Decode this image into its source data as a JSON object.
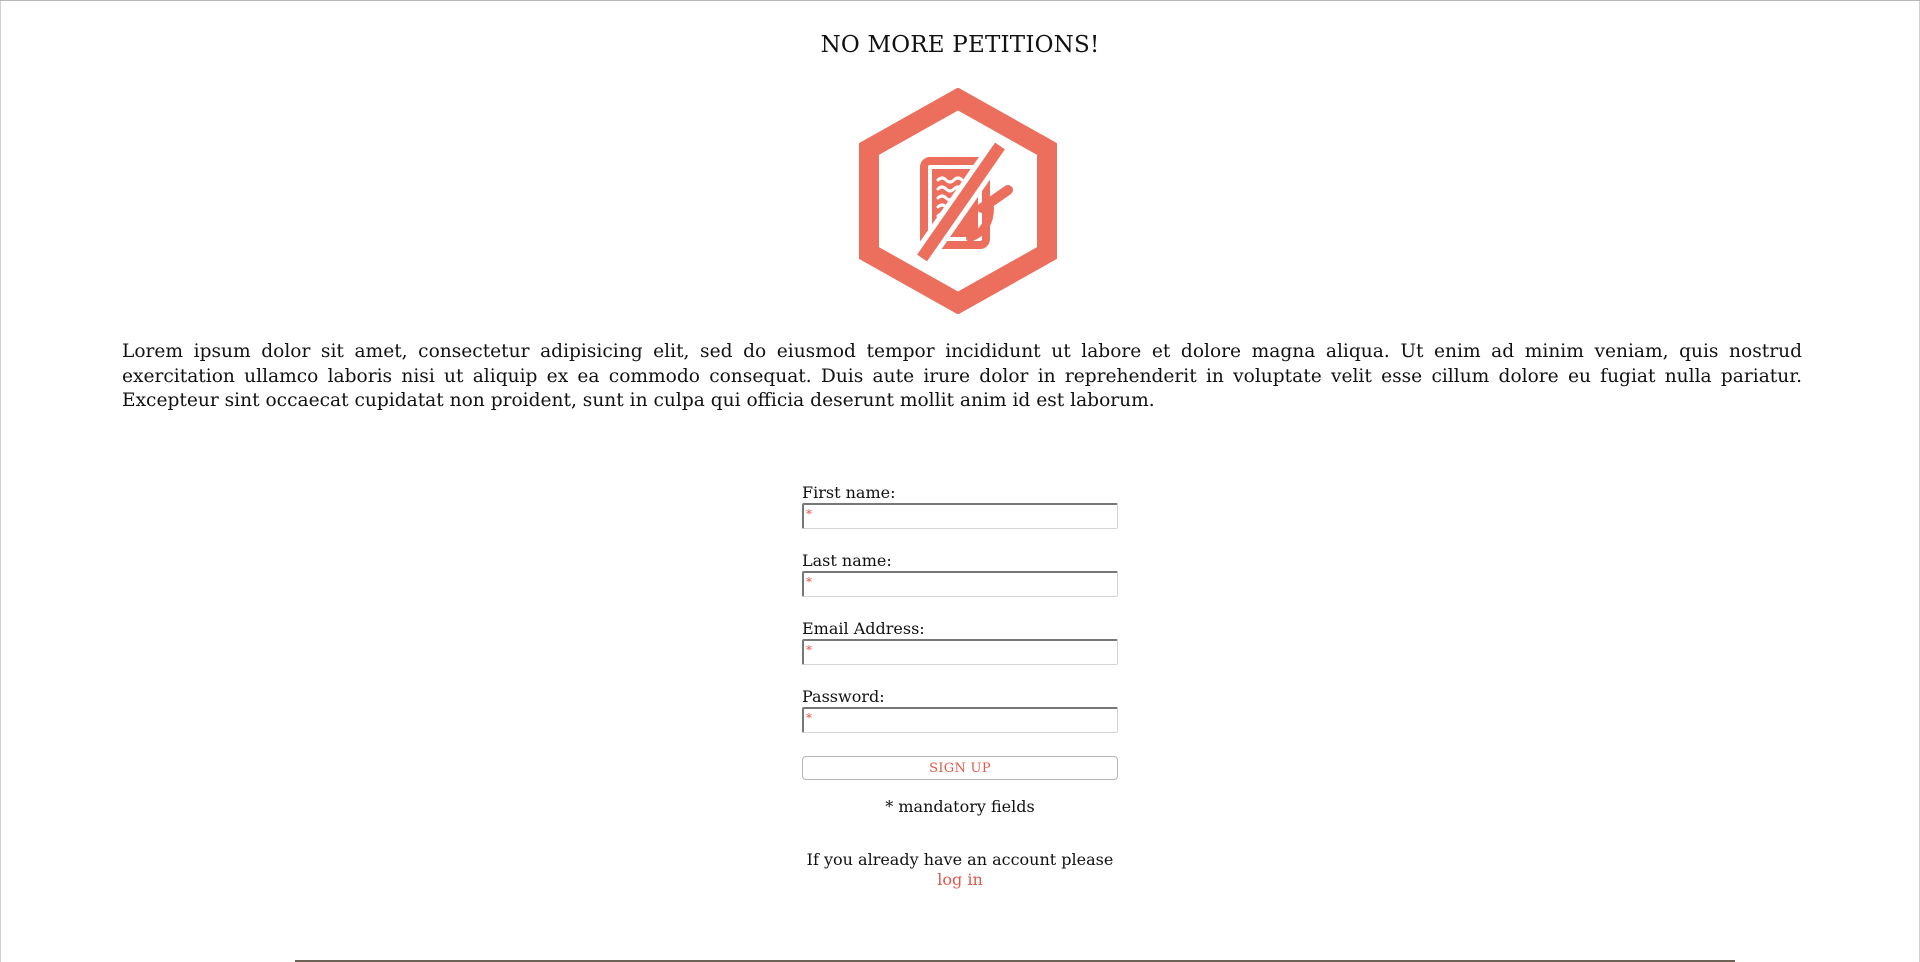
{
  "header": {
    "title": "NO MORE PETITIONS!"
  },
  "logo": {
    "icon": "no-petitions-hexagon-icon",
    "color": "#ec6f5e"
  },
  "intro": {
    "text": "Lorem ipsum dolor sit amet, consectetur adipisicing elit, sed do eiusmod tempor incididunt ut labore et dolore magna aliqua. Ut enim ad minim veniam, quis nostrud exercitation ullamco laboris nisi ut aliquip ex ea commodo consequat. Duis aute irure dolor in reprehenderit in voluptate velit esse cillum dolore eu fugiat nulla pariatur. Excepteur sint occaecat cupidatat non proident, sunt in culpa qui officia deserunt mollit anim id est laborum."
  },
  "form": {
    "fields": [
      {
        "label": "First name:",
        "value": "",
        "required_marker": "*"
      },
      {
        "label": "Last name:",
        "value": "",
        "required_marker": "*"
      },
      {
        "label": "Email Address:",
        "value": "",
        "required_marker": "*"
      },
      {
        "label": "Password:",
        "value": "",
        "required_marker": "*"
      }
    ],
    "submit_label": "SIGN UP",
    "mandatory_note": "* mandatory fields",
    "login_prompt": "If you already have an account please",
    "login_link": "log in"
  },
  "colors": {
    "accent": "#e0594a",
    "text": "#111111"
  }
}
